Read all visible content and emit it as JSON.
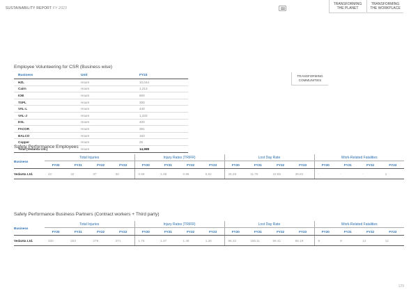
{
  "header": {
    "report_label": "SUSTAINABILITY REPORT",
    "report_year": "FY 2023",
    "menu_icon": "menu-icon",
    "tabs": [
      {
        "line1": "TRANSFORMING",
        "line2": "COMMUNITIES"
      },
      {
        "line1": "TRANSFORMING",
        "line2": "THE PLANET"
      },
      {
        "line1": "TRANSFORMING",
        "line2": "THE WORKPLACE"
      }
    ]
  },
  "volunteering": {
    "title": "Employee Volunteering for CSR (Business wise)",
    "headers": [
      "Business",
      "Unit",
      "FY23"
    ],
    "rows": [
      {
        "business": "HZL",
        "unit": "Hours",
        "value": "10,044"
      },
      {
        "business": "Cairn",
        "unit": "Hours",
        "value": "1,213"
      },
      {
        "business": "IOB",
        "unit": "Hours",
        "value": "800"
      },
      {
        "business": "TSPL",
        "unit": "Hours",
        "value": "300"
      },
      {
        "business": "VAL-L",
        "unit": "Hours",
        "value": "440"
      },
      {
        "business": "VAL-J",
        "unit": "Hours",
        "value": "1,333"
      },
      {
        "business": "ESL",
        "unit": "Hours",
        "value": "400"
      },
      {
        "business": "FACOR",
        "unit": "Hours",
        "value": "381"
      },
      {
        "business": "BALCO",
        "unit": "Hours",
        "value": "163"
      },
      {
        "business": "Copper",
        "unit": "Hours",
        "value": "25"
      }
    ],
    "total": {
      "business": "Total (Vedanta Ltd.)",
      "unit": "Hours",
      "value": "14,988"
    }
  },
  "safety_employees": {
    "title": "Safety Performance Employees",
    "business_header": "Business",
    "groups": [
      "Total Injuries",
      "Injury Rates (TRIFR)",
      "Lost Day Rate",
      "Work-Related Fatalities"
    ],
    "years": [
      "FY20",
      "FY21",
      "FY22",
      "FY23"
    ],
    "row": {
      "business": "Vedanta Ltd.",
      "values": [
        "42",
        "42",
        "37",
        "30",
        "0.69",
        "1.08",
        "0.96",
        "0.62",
        "25.29",
        "11.79",
        "22.85",
        "39.81",
        "-",
        "-",
        "-",
        "1"
      ]
    }
  },
  "safety_partners": {
    "title": "Safety Performance Business Partners (Contract workers + Third party)",
    "business_header": "Business",
    "groups": [
      "Total Injuries",
      "Injury Rates (TRIFR)",
      "Lost Day Rate",
      "Work-Related Fatalities"
    ],
    "years": [
      "FY20",
      "FY21",
      "FY22",
      "FY23"
    ],
    "row": {
      "business": "Vedanta Ltd.",
      "values": [
        "330",
        "253",
        "279",
        "271",
        "1.76",
        "1.57",
        "1.48",
        "1.28",
        "96.32",
        "158.11",
        "59.41",
        "86.19",
        "8",
        "8",
        "12",
        "12"
      ]
    }
  },
  "page_number": "129"
}
